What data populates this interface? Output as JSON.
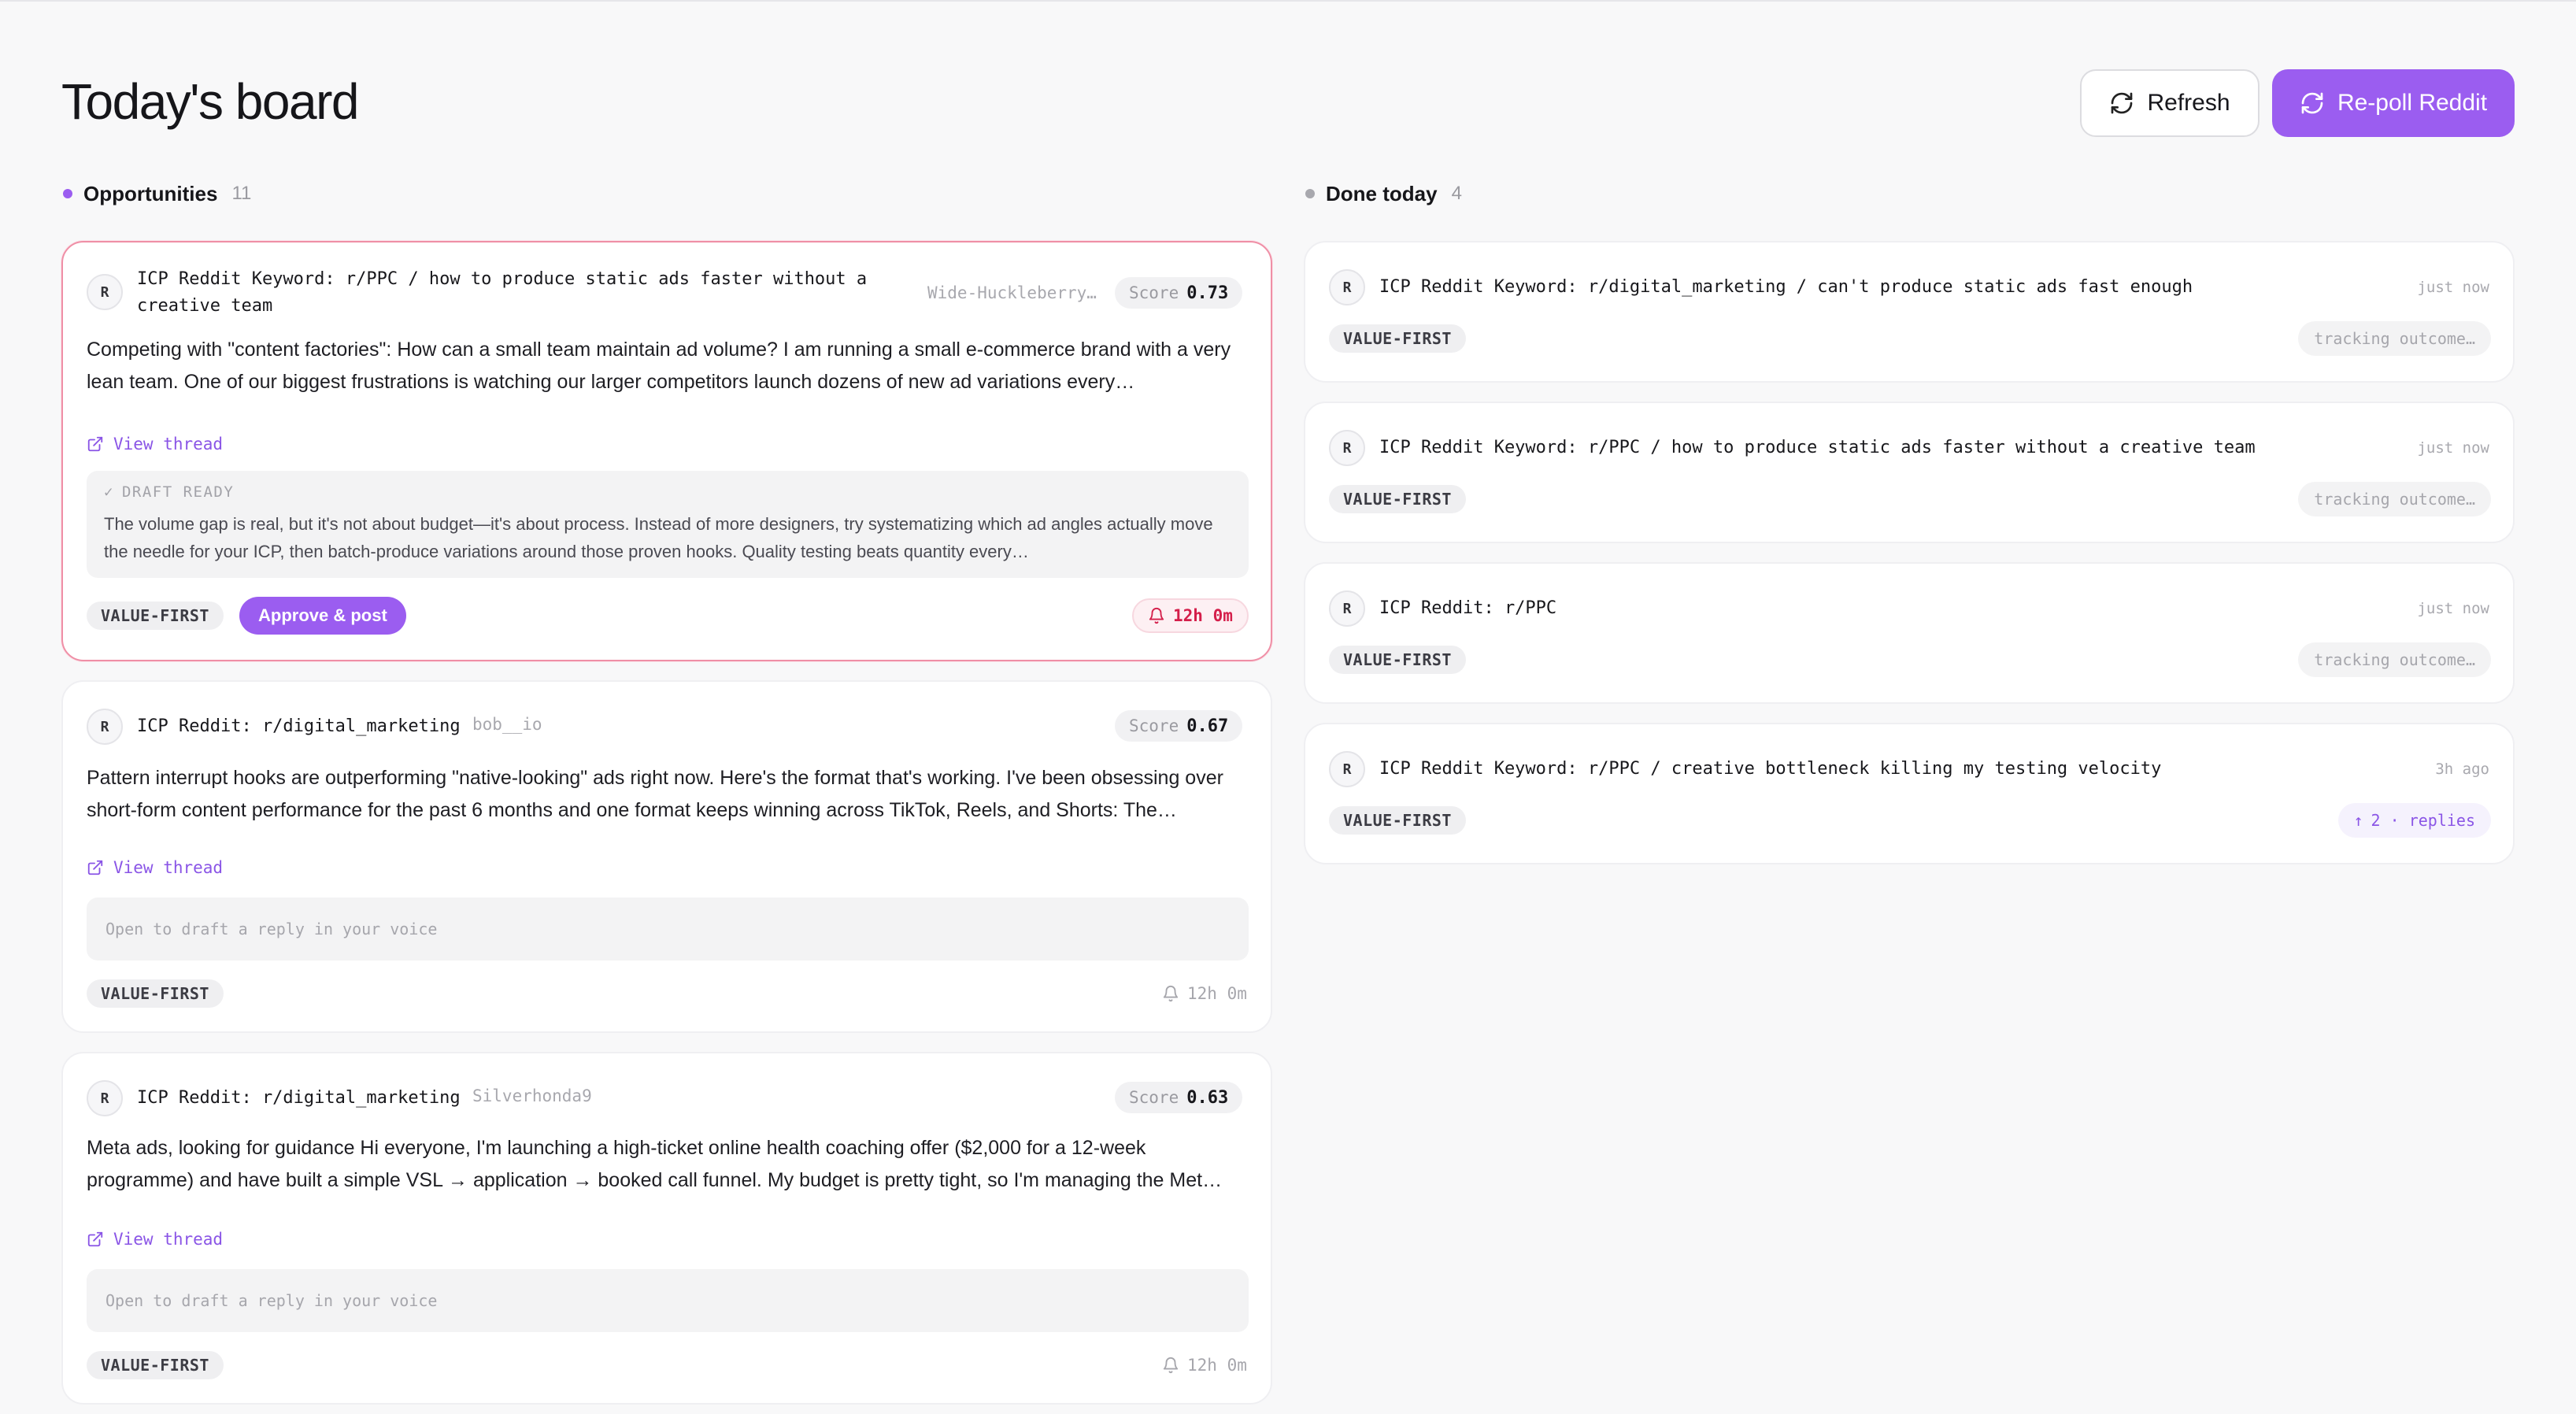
{
  "header": {
    "title": "Today's board",
    "refresh_label": "Refresh",
    "repoll_label": "Re-poll Reddit"
  },
  "colors": {
    "accent": "#9b5df0",
    "urgent": "#d41e4a",
    "opportunities_dot": "#9b5df0",
    "done_dot": "#a8a8ae"
  },
  "opportunities": {
    "label": "Opportunities",
    "count": "11",
    "cards": [
      {
        "avatar": "R",
        "title": "ICP Reddit Keyword: r/PPC / how to produce static ads faster without a creative team",
        "author": "Wide-Huckleberry…",
        "score_label": "Score",
        "score": "0.73",
        "body": "Competing with \"content factories\": How can a small team maintain ad volume? I am running a small e-commerce brand with a very lean team. One of our biggest frustrations is watching our larger competitors launch dozens of new ad variations every…",
        "view_thread": "View thread",
        "draft_label": "DRAFT READY",
        "draft": "The volume gap is real, but it's not about budget—it's about process. Instead of more designers, try systematizing which ad angles actually move the needle for your ICP, then batch-produce variations around those proven hooks. Quality testing beats quantity every…",
        "tag": "VALUE-FIRST",
        "approve_label": "Approve & post",
        "timer": "12h 0m"
      },
      {
        "avatar": "R",
        "title": "ICP Reddit: r/digital_marketing",
        "author": "bob__io",
        "score_label": "Score",
        "score": "0.67",
        "body": "Pattern interrupt hooks are outperforming \"native-looking\" ads right now. Here's the format that's working. I've been obsessing over short-form content performance for the past 6 months and one format keeps winning across TikTok, Reels, and Shorts: The…",
        "view_thread": "View thread",
        "placeholder": "Open to draft a reply in your voice",
        "tag": "VALUE-FIRST",
        "timer": "12h 0m"
      },
      {
        "avatar": "R",
        "title": "ICP Reddit: r/digital_marketing",
        "author": "Silverhonda9",
        "score_label": "Score",
        "score": "0.63",
        "body": "Meta ads, looking for guidance Hi everyone, I'm launching a high-ticket online health coaching offer ($2,000 for a 12-week programme) and have built a simple VSL → application → booked call funnel. My budget is pretty tight, so I'm managing the Met…",
        "view_thread": "View thread",
        "placeholder": "Open to draft a reply in your voice",
        "tag": "VALUE-FIRST",
        "timer": "12h 0m"
      }
    ]
  },
  "done": {
    "label": "Done today",
    "count": "4",
    "cards": [
      {
        "avatar": "R",
        "title": "ICP Reddit Keyword: r/digital_marketing / can't produce static ads fast enough",
        "time": "just now",
        "tag": "VALUE-FIRST",
        "status": "tracking outcome…"
      },
      {
        "avatar": "R",
        "title": "ICP Reddit Keyword: r/PPC / how to produce static ads faster without a creative team",
        "time": "just now",
        "tag": "VALUE-FIRST",
        "status": "tracking outcome…"
      },
      {
        "avatar": "R",
        "title": "ICP Reddit: r/PPC",
        "time": "just now",
        "tag": "VALUE-FIRST",
        "status": "tracking outcome…"
      },
      {
        "avatar": "R",
        "title": "ICP Reddit Keyword: r/PPC / creative bottleneck killing my testing velocity",
        "time": "3h ago",
        "tag": "VALUE-FIRST",
        "replies": "2 · replies"
      }
    ]
  }
}
